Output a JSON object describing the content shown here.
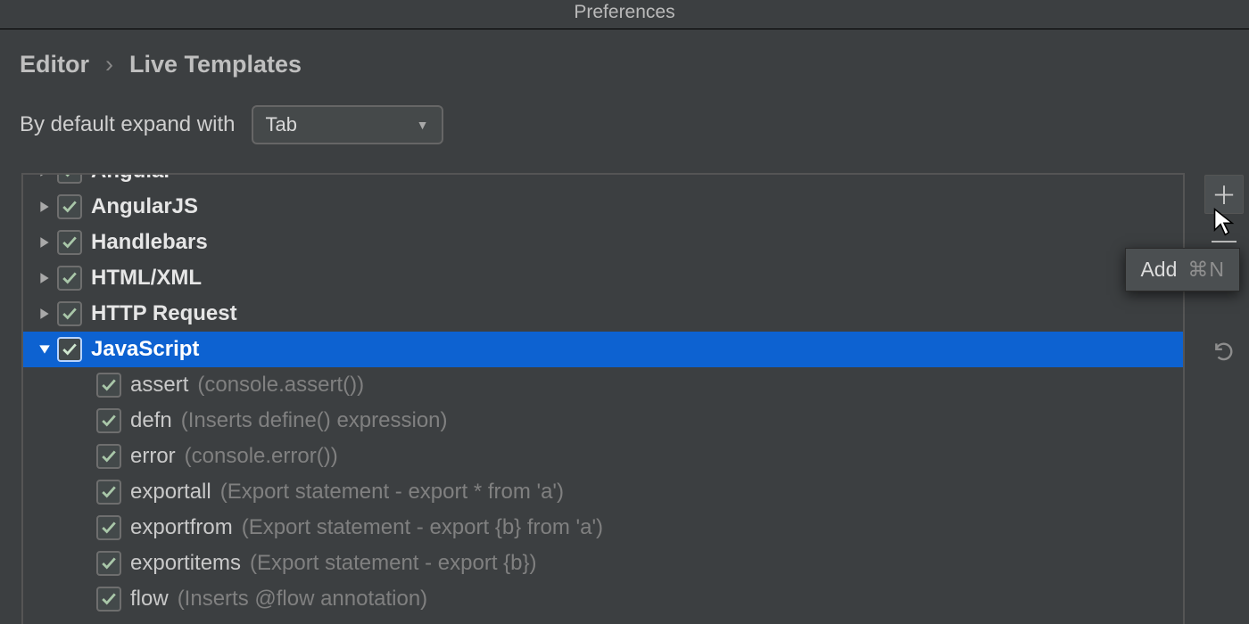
{
  "window": {
    "title": "Preferences"
  },
  "breadcrumb": {
    "section": "Editor",
    "page": "Live Templates"
  },
  "expand": {
    "label": "By default expand with",
    "value": "Tab"
  },
  "groups": {
    "cut": "Angular",
    "g0": "AngularJS",
    "g1": "Handlebars",
    "g2": "HTML/XML",
    "g3": "HTTP Request",
    "g4": "JavaScript"
  },
  "templates": [
    {
      "abbr": "assert",
      "desc": "(console.assert())"
    },
    {
      "abbr": "defn",
      "desc": "(Inserts define() expression)"
    },
    {
      "abbr": "error",
      "desc": "(console.error())"
    },
    {
      "abbr": "exportall",
      "desc": "(Export statement - export * from 'a')"
    },
    {
      "abbr": "exportfrom",
      "desc": "(Export statement - export {b} from 'a')"
    },
    {
      "abbr": "exportitems",
      "desc": "(Export statement - export {b})"
    },
    {
      "abbr": "flow",
      "desc": "(Inserts @flow annotation)"
    }
  ],
  "tooltip": {
    "label": "Add",
    "shortcut": "⌘N"
  }
}
